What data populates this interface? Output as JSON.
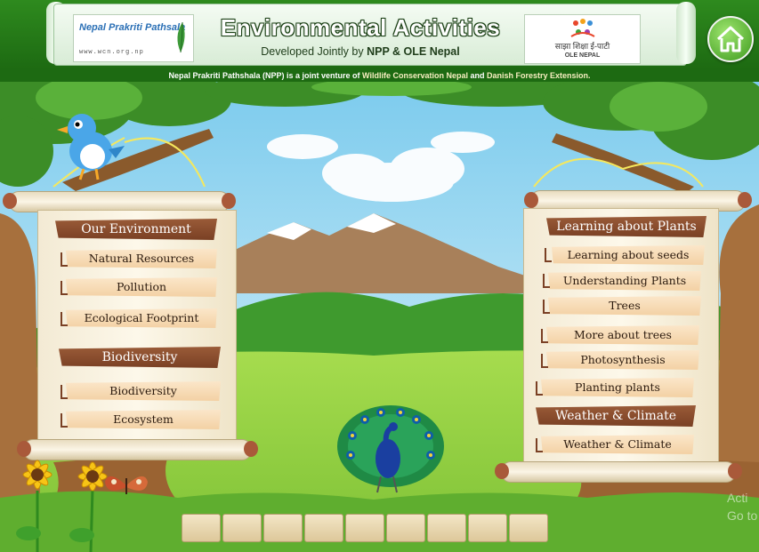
{
  "header": {
    "title": "Environmental Activities",
    "subtitle_prefix": "Developed Jointly by ",
    "subtitle_bold": "NPP & OLE Nepal",
    "band_prefix": "Nepal Prakriti Pathshala (NPP) is a joint venture of ",
    "band_org1": "Wildlife Conservation Nepal",
    "band_and": " and ",
    "band_org2": "Danish Forestry Extension.",
    "logo_left_name": "Nepal Prakriti Pathsala",
    "logo_left_url": "www.wcn.org.np",
    "logo_right_name": "साझा शिक्षा ई-पाटी",
    "logo_right_sub": "OLE NEPAL"
  },
  "left_panel": {
    "section1": "Our Environment",
    "items1": [
      "Natural Resources",
      "Pollution",
      "Ecological Footprint"
    ],
    "section2": "Biodiversity",
    "items2": [
      "Biodiversity",
      "Ecosystem"
    ]
  },
  "right_panel": {
    "section1": "Learning about Plants",
    "items1": [
      "Learning about seeds",
      "Understanding Plants",
      "Trees",
      "More about trees",
      "Photosynthesis",
      "Planting plants"
    ],
    "section2": "Weather & Climate",
    "items2": [
      "Weather & Climate"
    ]
  },
  "watermark": {
    "line1": "Acti",
    "line2": "Go to"
  },
  "colors": {
    "header_green": "#1d6a12",
    "section_brown": "#7a4024",
    "item_peach": "#f3d1a4",
    "sky_blue": "#6ec3ea",
    "grass_green": "#8ecf3a"
  },
  "icons": [
    "home-icon",
    "bird-icon",
    "peacock-icon",
    "sunflower-icon",
    "butterfly-icon"
  ]
}
